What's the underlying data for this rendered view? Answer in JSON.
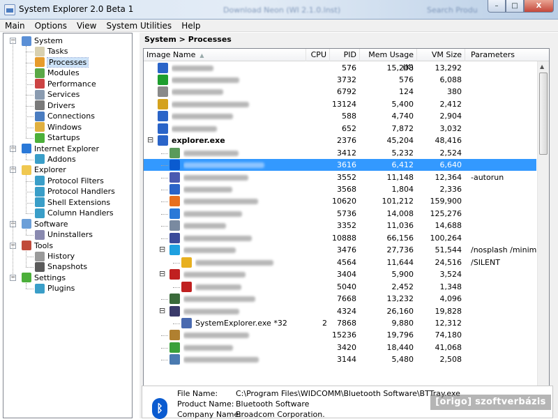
{
  "window": {
    "title": "System Explorer 2.0 Beta 1",
    "ghost_text": [
      "Download Neon (WI 2.1.0.lnst)",
      "Search Produ"
    ],
    "buttons": {
      "minimize": "–",
      "maximize": "□",
      "close": "X"
    }
  },
  "menu": [
    "Main",
    "Options",
    "View",
    "System Utilities",
    "Help"
  ],
  "sidebar": [
    {
      "label": "System",
      "level": 0,
      "icon": "system-icon",
      "color": "#5a8fd6",
      "expanded": true
    },
    {
      "label": "Tasks",
      "level": 1,
      "icon": "tasks-icon",
      "color": "#d8d0b0"
    },
    {
      "label": "Processes",
      "level": 1,
      "icon": "processes-icon",
      "color": "#e69b2b",
      "selected": true
    },
    {
      "label": "Modules",
      "level": 1,
      "icon": "modules-icon",
      "color": "#5aa846"
    },
    {
      "label": "Performance",
      "level": 1,
      "icon": "performance-icon",
      "color": "#c44"
    },
    {
      "label": "Services",
      "level": 1,
      "icon": "services-icon",
      "color": "#8a9bb0"
    },
    {
      "label": "Drivers",
      "level": 1,
      "icon": "drivers-icon",
      "color": "#7a7a7a"
    },
    {
      "label": "Connections",
      "level": 1,
      "icon": "connections-icon",
      "color": "#4a7cc0"
    },
    {
      "label": "Windows",
      "level": 1,
      "icon": "windows-icon",
      "color": "#e0b040"
    },
    {
      "label": "Startups",
      "level": 1,
      "icon": "startups-icon",
      "color": "#4caf3a"
    },
    {
      "label": "Internet Explorer",
      "level": 0,
      "icon": "internet-explorer-icon",
      "color": "#2a79d8",
      "expanded": true
    },
    {
      "label": "Addons",
      "level": 1,
      "icon": "addons-icon",
      "color": "#3a9ec8"
    },
    {
      "label": "Explorer",
      "level": 0,
      "icon": "folder-icon",
      "color": "#f0c850",
      "expanded": true
    },
    {
      "label": "Protocol Filters",
      "level": 1,
      "icon": "puzzle-icon",
      "color": "#3a9ec8"
    },
    {
      "label": "Protocol Handlers",
      "level": 1,
      "icon": "puzzle-icon",
      "color": "#3a9ec8"
    },
    {
      "label": "Shell Extensions",
      "level": 1,
      "icon": "puzzle-icon",
      "color": "#3a9ec8"
    },
    {
      "label": "Column Handlers",
      "level": 1,
      "icon": "puzzle-icon",
      "color": "#3a9ec8"
    },
    {
      "label": "Software",
      "level": 0,
      "icon": "software-icon",
      "color": "#6b9fd8",
      "expanded": true
    },
    {
      "label": "Uninstallers",
      "level": 1,
      "icon": "uninstallers-icon",
      "color": "#8a8ab0"
    },
    {
      "label": "Tools",
      "level": 0,
      "icon": "tools-icon",
      "color": "#c04a3a",
      "expanded": true
    },
    {
      "label": "History",
      "level": 1,
      "icon": "history-icon",
      "color": "#9a9a9a"
    },
    {
      "label": "Snapshots",
      "level": 1,
      "icon": "snapshots-icon",
      "color": "#5a5a5a"
    },
    {
      "label": "Settings",
      "level": 0,
      "icon": "settings-icon",
      "color": "#4caf3a",
      "expanded": true
    },
    {
      "label": "Plugins",
      "level": 1,
      "icon": "puzzle-icon",
      "color": "#3a9ec8"
    }
  ],
  "breadcrumb": "System > Processes",
  "columns": {
    "image_name": "Image Name",
    "cpu": "CPU",
    "pid": "PID",
    "mem": "Mem Usage (K)",
    "vm": "VM Size",
    "params": "Parameters"
  },
  "processes": [
    {
      "name": "",
      "depth": 0,
      "icon": "window-icon",
      "icolor": "#2a64c8",
      "cpu": "",
      "pid": "576",
      "mem": "15,208",
      "vm": "13,292",
      "params": ""
    },
    {
      "name": "",
      "depth": 0,
      "icon": "windows-flag-icon",
      "icolor": "#1e9e2e",
      "cpu": "",
      "pid": "3732",
      "mem": "576",
      "vm": "6,088",
      "params": ""
    },
    {
      "name": "",
      "depth": 0,
      "icon": "app-icon",
      "icolor": "#8a8a8a",
      "cpu": "",
      "pid": "6792",
      "mem": "124",
      "vm": "380",
      "params": ""
    },
    {
      "name": "",
      "depth": 0,
      "icon": "windows-flag-icon",
      "icolor": "#d4a21e",
      "cpu": "",
      "pid": "13124",
      "mem": "5,400",
      "vm": "2,412",
      "params": ""
    },
    {
      "name": "",
      "depth": 0,
      "icon": "window-icon",
      "icolor": "#2a64c8",
      "cpu": "",
      "pid": "588",
      "mem": "4,740",
      "vm": "2,904",
      "params": ""
    },
    {
      "name": "",
      "depth": 0,
      "icon": "window-icon",
      "icolor": "#2a64c8",
      "cpu": "",
      "pid": "652",
      "mem": "7,872",
      "vm": "3,032",
      "params": ""
    },
    {
      "name": "explorer.exe",
      "depth": 0,
      "icon": "explorer-icon",
      "icolor": "#2a64c8",
      "bold": true,
      "expander": "⊟",
      "cpu": "",
      "pid": "2376",
      "mem": "45,204",
      "vm": "48,416",
      "params": ""
    },
    {
      "name": "",
      "depth": 1,
      "icon": "app-icon",
      "icolor": "#5a9a5a",
      "cpu": "",
      "pid": "3412",
      "mem": "5,232",
      "vm": "2,524",
      "params": ""
    },
    {
      "name": "",
      "depth": 1,
      "icon": "bluetooth-icon",
      "icolor": "#0a5bd0",
      "selected": true,
      "cpu": "",
      "pid": "3616",
      "mem": "6,412",
      "vm": "6,640",
      "params": ""
    },
    {
      "name": "",
      "depth": 1,
      "icon": "app-icon",
      "icolor": "#4a5ab0",
      "cpu": "",
      "pid": "3552",
      "mem": "11,148",
      "vm": "12,364",
      "params": "-autorun"
    },
    {
      "name": "",
      "depth": 1,
      "icon": "window-icon",
      "icolor": "#2a64c8",
      "cpu": "",
      "pid": "3568",
      "mem": "1,804",
      "vm": "2,336",
      "params": ""
    },
    {
      "name": "",
      "depth": 1,
      "icon": "firefox-icon",
      "icolor": "#e8701e",
      "cpu": "",
      "pid": "10620",
      "mem": "101,212",
      "vm": "159,900",
      "params": ""
    },
    {
      "name": "",
      "depth": 1,
      "icon": "internet-explorer-icon",
      "icolor": "#2a79d8",
      "cpu": "",
      "pid": "5736",
      "mem": "14,008",
      "vm": "125,276",
      "params": ""
    },
    {
      "name": "",
      "depth": 1,
      "icon": "app-icon",
      "icolor": "#7a8aa0",
      "cpu": "",
      "pid": "3352",
      "mem": "11,036",
      "vm": "14,688",
      "params": ""
    },
    {
      "name": "",
      "depth": 1,
      "icon": "app-icon",
      "icolor": "#3a4a9a",
      "cpu": "",
      "pid": "10888",
      "mem": "66,156",
      "vm": "100,264",
      "params": ""
    },
    {
      "name": "",
      "depth": 1,
      "icon": "skype-icon",
      "icolor": "#1ea0e0",
      "expander": "⊟",
      "cpu": "",
      "pid": "3476",
      "mem": "27,736",
      "vm": "51,544",
      "params": "/nosplash /minimize"
    },
    {
      "name": "",
      "depth": 2,
      "icon": "app-icon",
      "icolor": "#e8b020",
      "cpu": "",
      "pid": "4564",
      "mem": "11,644",
      "vm": "24,516",
      "params": "/SILENT"
    },
    {
      "name": "",
      "depth": 1,
      "icon": "app-icon",
      "icolor": "#c02020",
      "expander": "⊟",
      "cpu": "",
      "pid": "3404",
      "mem": "5,900",
      "vm": "3,524",
      "params": ""
    },
    {
      "name": "",
      "depth": 2,
      "icon": "app-icon",
      "icolor": "#c02020",
      "cpu": "",
      "pid": "5040",
      "mem": "2,452",
      "vm": "1,348",
      "params": ""
    },
    {
      "name": "",
      "depth": 1,
      "icon": "app-icon",
      "icolor": "#3a6a3a",
      "cpu": "",
      "pid": "7668",
      "mem": "13,232",
      "vm": "4,096",
      "params": ""
    },
    {
      "name": "",
      "depth": 1,
      "icon": "disk-icon",
      "icolor": "#3a3a6a",
      "expander": "⊟",
      "cpu": "",
      "pid": "4324",
      "mem": "26,160",
      "vm": "19,828",
      "params": ""
    },
    {
      "name": "SystemExplorer.exe *32",
      "depth": 2,
      "icon": "system-explorer-icon",
      "icolor": "#4a6ab0",
      "cpu": "2",
      "pid": "7868",
      "mem": "9,880",
      "vm": "12,312",
      "params": ""
    },
    {
      "name": "",
      "depth": 1,
      "icon": "app-icon",
      "icolor": "#b08030",
      "cpu": "",
      "pid": "15236",
      "mem": "19,796",
      "vm": "74,180",
      "params": ""
    },
    {
      "name": "",
      "depth": 1,
      "icon": "app-icon",
      "icolor": "#3aa03a",
      "cpu": "",
      "pid": "3420",
      "mem": "18,440",
      "vm": "41,068",
      "params": ""
    },
    {
      "name": "",
      "depth": 1,
      "icon": "app-icon",
      "icolor": "#4a7ab0",
      "cpu": "",
      "pid": "3144",
      "mem": "5,480",
      "vm": "2,508",
      "params": ""
    }
  ],
  "details": {
    "file_name_label": "File Name:",
    "file_name": "C:\\Program Files\\WIDCOMM\\Bluetooth Software\\BTTray.exe",
    "product_name_label": "Product Name:",
    "product_name": "Bluetooth Software",
    "company_name_label": "Company Name:",
    "company_name": "Broadcom Corporation."
  },
  "watermark": "[origo] szoftverbázis"
}
